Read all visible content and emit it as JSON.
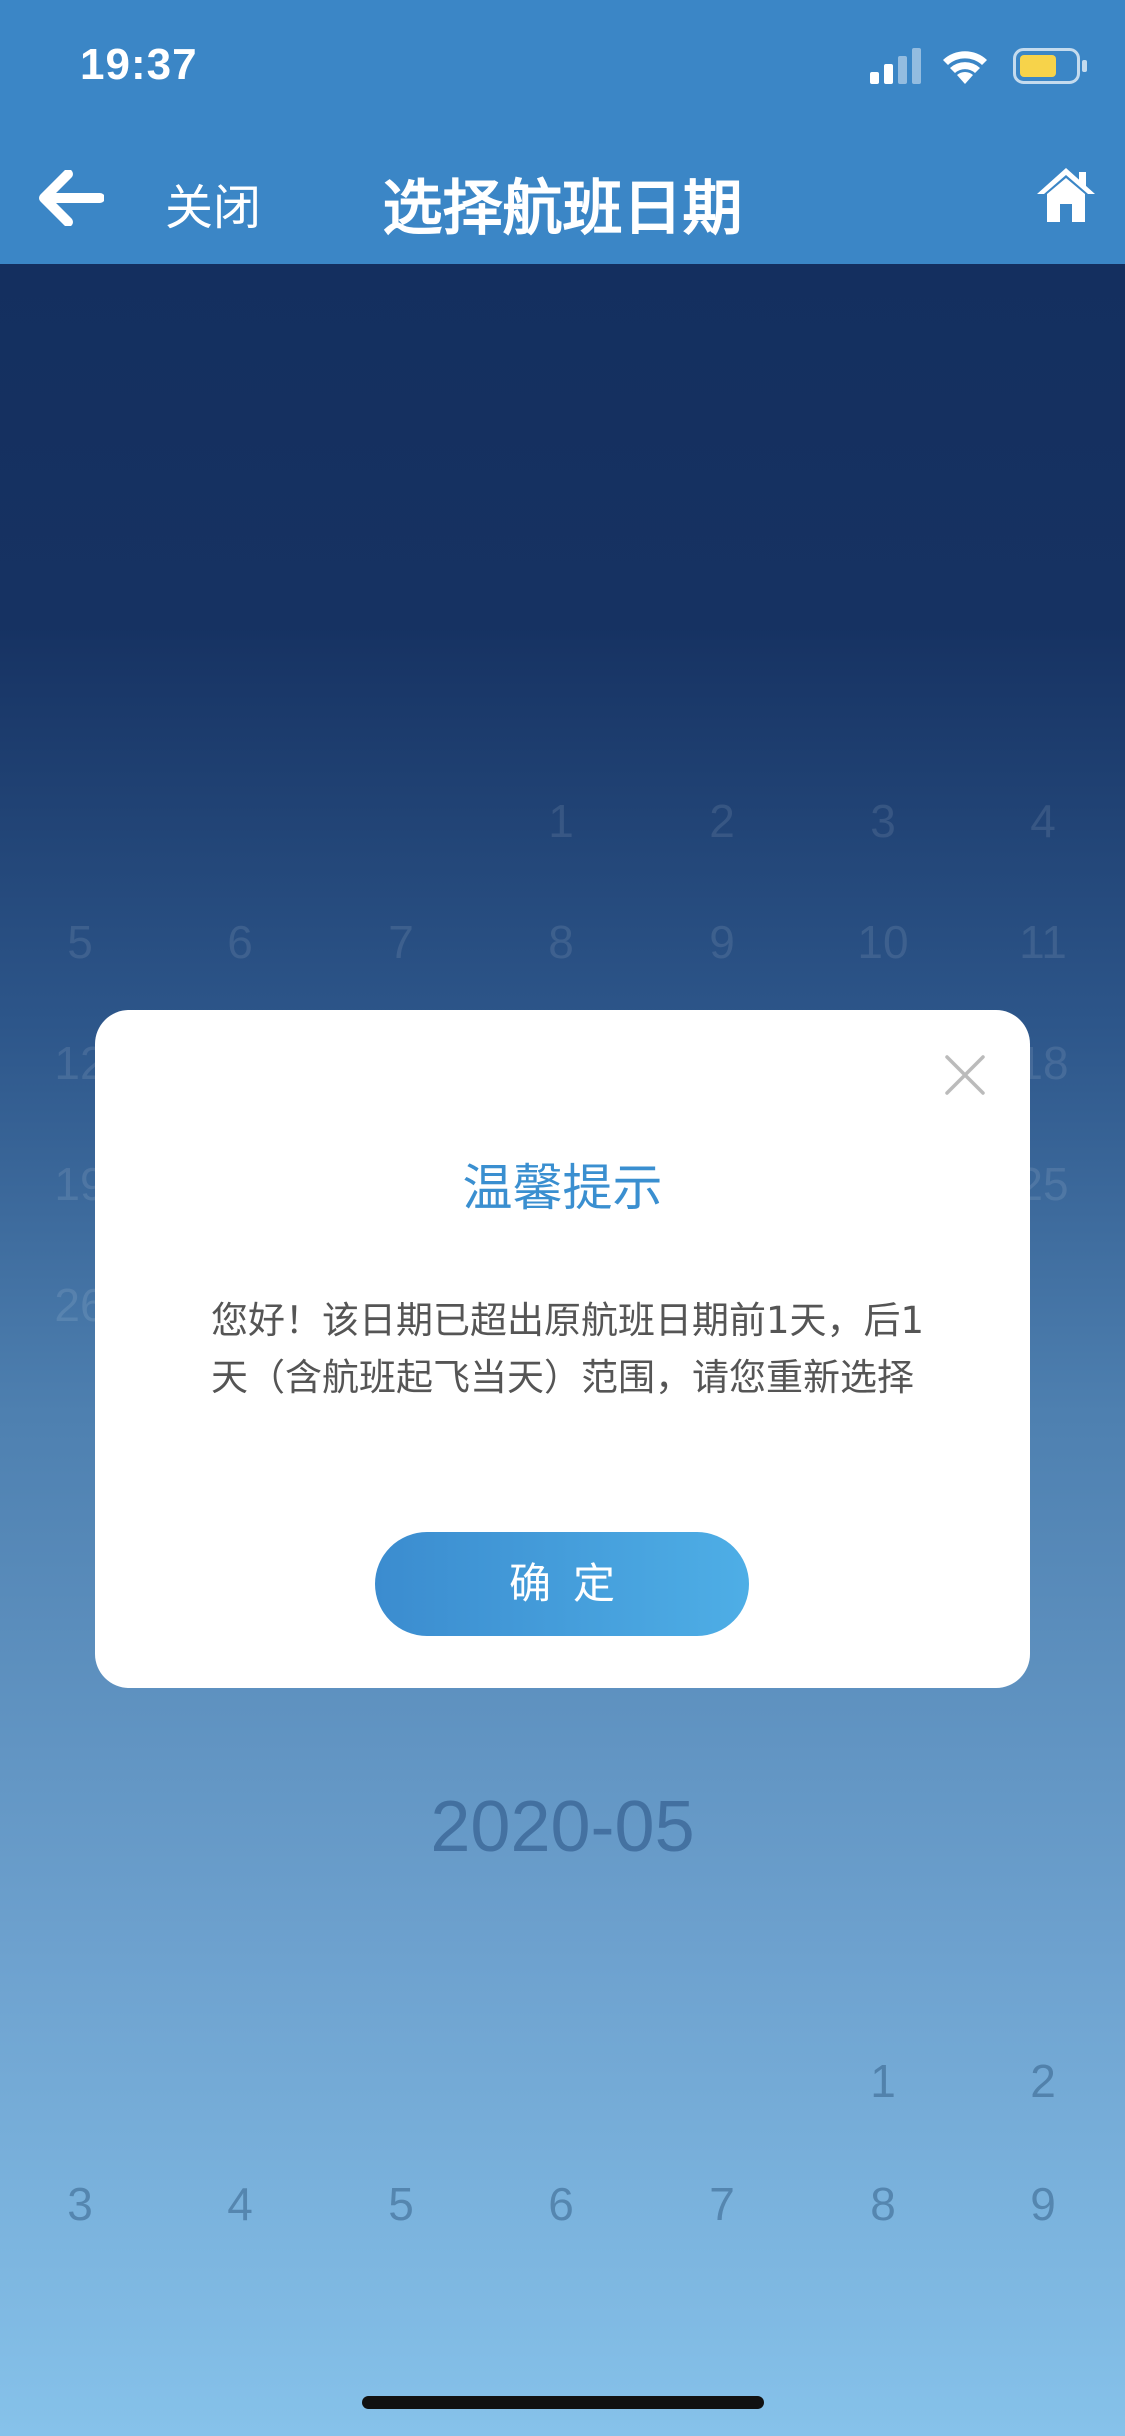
{
  "status_bar": {
    "time": "19:37"
  },
  "nav": {
    "close_label": "关闭",
    "title": "选择航班日期"
  },
  "calendar": {
    "rows": [
      {
        "cells": [
          "",
          "",
          "",
          "1",
          "2",
          "3",
          "4"
        ]
      },
      {
        "cells": [
          "5",
          "6",
          "7",
          "8",
          "9",
          "10",
          "11"
        ]
      },
      {
        "cells": [
          "12",
          "",
          "",
          "",
          "",
          "",
          "18"
        ]
      },
      {
        "cells": [
          "19",
          "",
          "",
          "",
          "",
          "",
          "25"
        ]
      },
      {
        "cells": [
          "26",
          "",
          "",
          "",
          "",
          "",
          ""
        ]
      }
    ],
    "next_month_label": "2020-05",
    "next_month_rows": [
      {
        "cells": [
          "",
          "",
          "",
          "",
          "",
          "1",
          "2"
        ]
      },
      {
        "cells": [
          "3",
          "4",
          "5",
          "6",
          "7",
          "8",
          "9"
        ]
      }
    ]
  },
  "modal": {
    "title": "温馨提示",
    "message": "您好！该日期已超出原航班日期前1天，后1天（含航班起飞当天）范围，请您重新选择",
    "confirm_label": "确定"
  },
  "colors": {
    "header": "#3b86c6",
    "accent": "#3a8fd0",
    "battery": "#f7d34a"
  }
}
